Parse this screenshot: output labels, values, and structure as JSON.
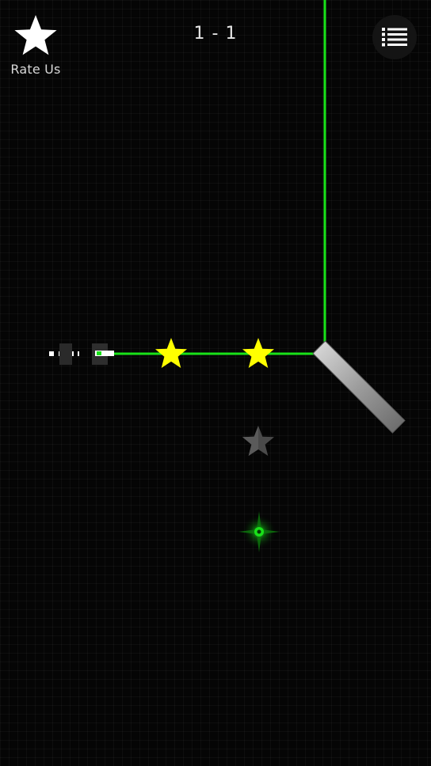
{
  "header": {
    "rate_us_label": "Rate Us",
    "level": "1 - 1"
  },
  "icons": {
    "rate": "star-icon",
    "menu": "list-menu-icon"
  },
  "colors": {
    "laser": "#19e219",
    "star_collected": "#ffff00",
    "star_uncollected": "#4a4a4a",
    "mirror": "#9a9a9a",
    "target": "#10d010",
    "background": "#050505"
  },
  "board": {
    "stars_total": 3,
    "stars_hit": 2
  }
}
